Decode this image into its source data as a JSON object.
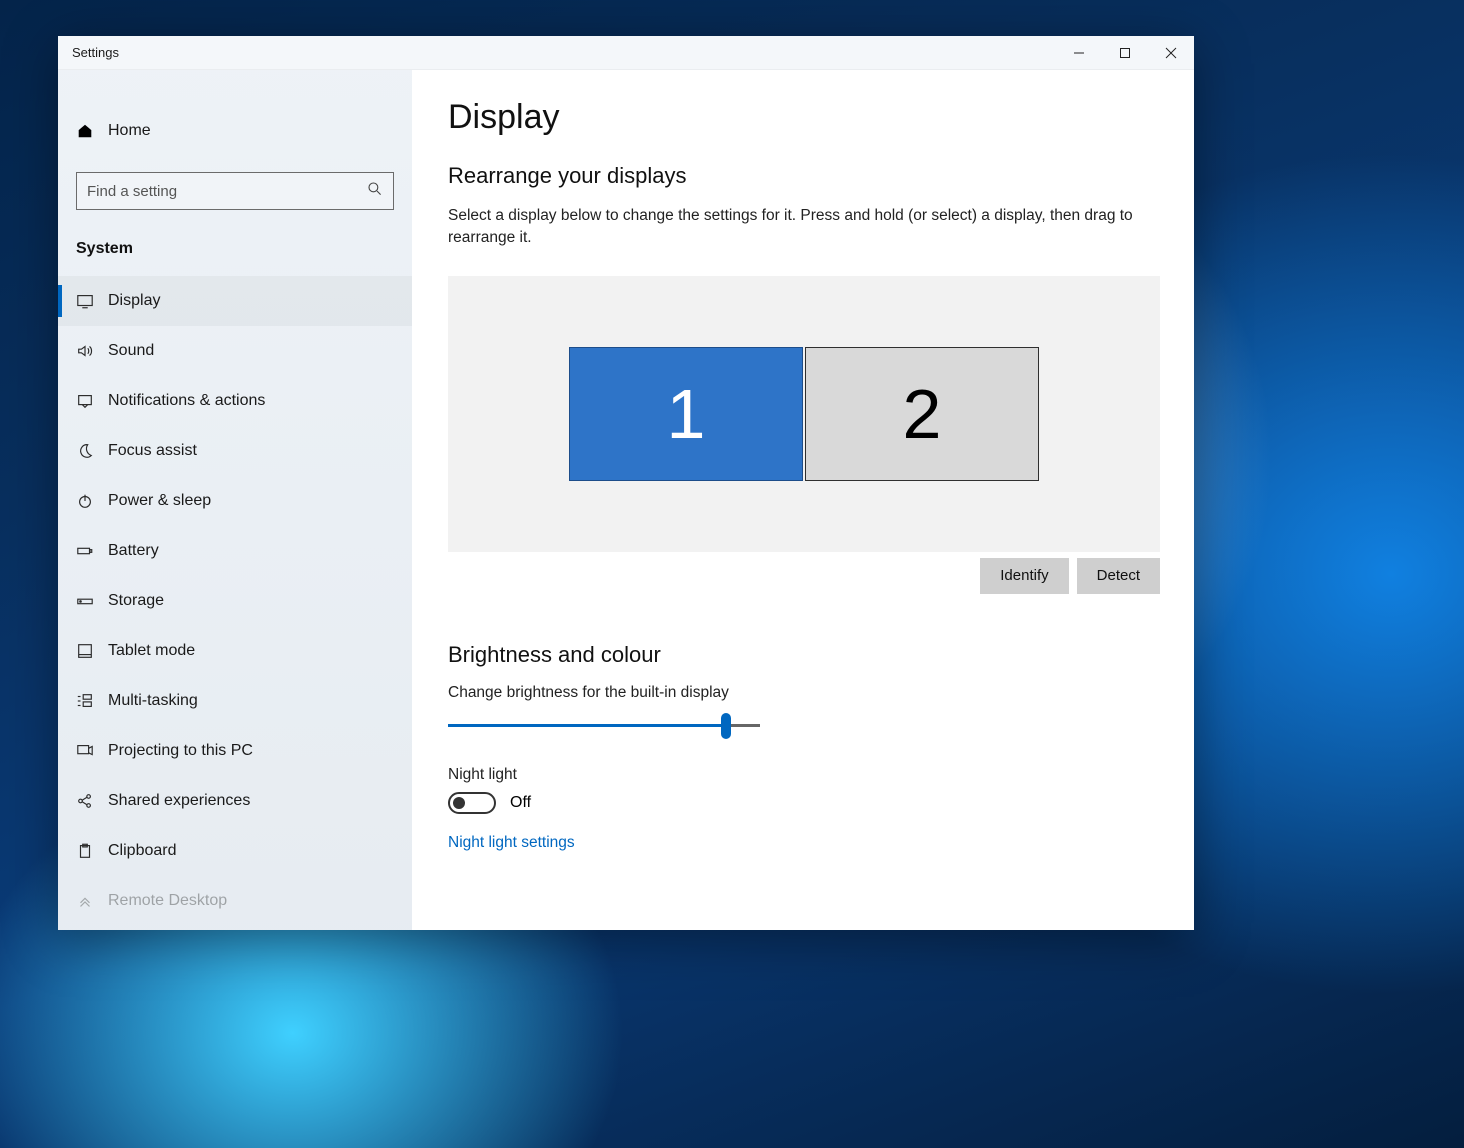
{
  "window": {
    "title": "Settings"
  },
  "sidebar": {
    "home_label": "Home",
    "search_placeholder": "Find a setting",
    "category": "System",
    "items": [
      {
        "label": "Display",
        "icon": "display-icon",
        "active": true
      },
      {
        "label": "Sound",
        "icon": "sound-icon",
        "active": false
      },
      {
        "label": "Notifications & actions",
        "icon": "notifications-icon",
        "active": false
      },
      {
        "label": "Focus assist",
        "icon": "moon-icon",
        "active": false
      },
      {
        "label": "Power & sleep",
        "icon": "power-icon",
        "active": false
      },
      {
        "label": "Battery",
        "icon": "battery-icon",
        "active": false
      },
      {
        "label": "Storage",
        "icon": "storage-icon",
        "active": false
      },
      {
        "label": "Tablet mode",
        "icon": "tablet-icon",
        "active": false
      },
      {
        "label": "Multi-tasking",
        "icon": "multitask-icon",
        "active": false
      },
      {
        "label": "Projecting to this PC",
        "icon": "project-icon",
        "active": false
      },
      {
        "label": "Shared experiences",
        "icon": "share-icon",
        "active": false
      },
      {
        "label": "Clipboard",
        "icon": "clipboard-icon",
        "active": false
      },
      {
        "label": "Remote Desktop",
        "icon": "remote-icon",
        "active": false
      }
    ]
  },
  "main": {
    "title": "Display",
    "rearrange": {
      "title": "Rearrange your displays",
      "description": "Select a display below to change the settings for it. Press and hold (or select) a display, then drag to rearrange it.",
      "displays": [
        {
          "id": "1",
          "selected": true
        },
        {
          "id": "2",
          "selected": false
        }
      ],
      "identify_label": "Identify",
      "detect_label": "Detect"
    },
    "brightness": {
      "title": "Brightness and colour",
      "slider_label": "Change brightness for the built-in display",
      "slider_value": 89,
      "night_light_label": "Night light",
      "night_light_state": "Off",
      "night_light_settings_link": "Night light settings"
    }
  }
}
